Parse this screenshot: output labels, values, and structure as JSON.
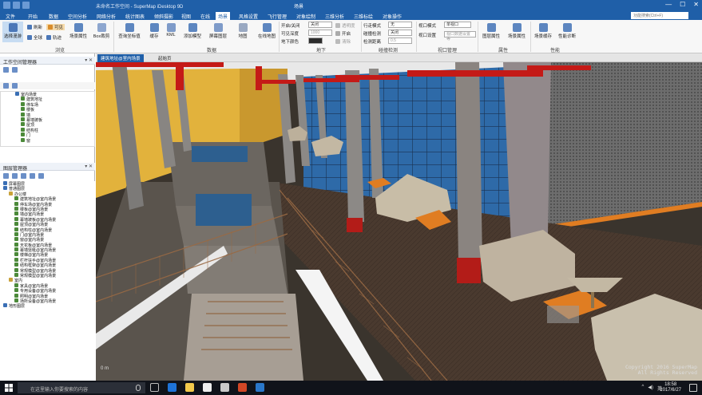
{
  "titlebar": {
    "document": "未命名工作空间 - SuperMap iDesktop 9D",
    "context_tab": "场景",
    "search_placeholder": "功能搜索(Ctrl+F)"
  },
  "ribbon_tabs": [
    "文件",
    "开始",
    "数据",
    "空间分析",
    "网络分析",
    "统计图表",
    "倾斜摄影",
    "视图",
    "在线",
    "场景",
    "风格设置",
    "飞行管理",
    "对象绘制",
    "三维分析",
    "三维标绘",
    "对象操作"
  ],
  "active_tab": "场景",
  "ribbon": {
    "browse": {
      "label": "浏览",
      "select_mode": "选择漫游",
      "refresh": "刷新",
      "fullscreen": "全球",
      "visible": "可见",
      "track": "轨迹",
      "scene_props": "场景属性",
      "box": "Box裁剪"
    },
    "data": {
      "label": "数据",
      "query": "查询坐标值",
      "cache": "缓存",
      "kml": "KML",
      "add_model": "添加模型",
      "screen_layer": "屏幕图层",
      "online_map": "在线地图",
      "underground": "地图"
    },
    "underground": {
      "label": "地下",
      "open_close": "开启/关闭",
      "visible_depth": "可见深度",
      "under_color": "地下颜色",
      "close_value": "关闭",
      "depth_value": "1000",
      "transparency": "透明度",
      "open": "开启",
      "clear": "清除"
    },
    "collision": {
      "label": "碰撞检测",
      "walk_mode": "行走模式",
      "collision_detect": "碰撞检测",
      "detect_distance": "检测距离",
      "walk_value": "无",
      "collision_value": "关闭",
      "distance_value": "0.5"
    },
    "viewport": {
      "label": "视口管理",
      "viewport_mode": "视口模式",
      "single_viewport": "单视口",
      "viewport_settings": "视口设置",
      "viewport_value": "视口数据设置等"
    },
    "properties": {
      "label": "属性",
      "layer_props": "图层属性",
      "scene_props": "场景属性"
    },
    "performance": {
      "label": "性能",
      "scene_cache": "场景缓存",
      "perf_diag": "性能诊断"
    }
  },
  "workspace_panel": {
    "title": "工作空间管理器",
    "tree": [
      {
        "level": 2,
        "text": "室内场景",
        "color": "#3a6fb5"
      },
      {
        "level": 3,
        "text": "建筑地址",
        "color": "#4c8a3a"
      },
      {
        "level": 3,
        "text": "停车场",
        "color": "#4c8a3a"
      },
      {
        "level": 3,
        "text": "楼板",
        "color": "#4c8a3a"
      },
      {
        "level": 3,
        "text": "墙",
        "color": "#4c8a3a"
      },
      {
        "level": 3,
        "text": "幕墙玻板",
        "color": "#4c8a3a"
      },
      {
        "level": 3,
        "text": "屋顶",
        "color": "#4c8a3a"
      },
      {
        "level": 3,
        "text": "结构柱",
        "color": "#4c8a3a"
      },
      {
        "level": 3,
        "text": "门",
        "color": "#4c8a3a"
      },
      {
        "level": 3,
        "text": "窗",
        "color": "#4c8a3a"
      }
    ]
  },
  "layer_panel": {
    "title": "图层管理器",
    "tree": [
      {
        "level": 0,
        "text": "屏幕图层",
        "color": "#3a6fb5"
      },
      {
        "level": 0,
        "text": "普通图层",
        "color": "#3a6fb5"
      },
      {
        "level": 1,
        "text": "办公楼",
        "color": "#c9a23a"
      },
      {
        "level": 2,
        "text": "建筑地址@室内场景",
        "color": "#4c8a3a"
      },
      {
        "level": 2,
        "text": "停车场@室内场景",
        "color": "#4c8a3a"
      },
      {
        "level": 2,
        "text": "楼板@室内场景",
        "color": "#4c8a3a"
      },
      {
        "level": 2,
        "text": "墙@室内场景",
        "color": "#4c8a3a"
      },
      {
        "level": 2,
        "text": "幕墙玻板@室内场景",
        "color": "#4c8a3a"
      },
      {
        "level": 2,
        "text": "屋顶@室内场景",
        "color": "#4c8a3a"
      },
      {
        "level": 2,
        "text": "结构柱@室内场景",
        "color": "#4c8a3a"
      },
      {
        "level": 2,
        "text": "门@室内场景",
        "color": "#4c8a3a"
      },
      {
        "level": 2,
        "text": "窗@室内场景",
        "color": "#4c8a3a"
      },
      {
        "level": 2,
        "text": "天花板@室内场景",
        "color": "#4c8a3a"
      },
      {
        "level": 2,
        "text": "幕墙竖梃@室内场景",
        "color": "#4c8a3a"
      },
      {
        "level": 2,
        "text": "楼梯@室内场景",
        "color": "#4c8a3a"
      },
      {
        "level": 2,
        "text": "栏杆扶手@室内场景",
        "color": "#4c8a3a"
      },
      {
        "level": 2,
        "text": "结构框架@室内场景",
        "color": "#4c8a3a"
      },
      {
        "level": 2,
        "text": "常规模型@室内场景",
        "color": "#4c8a3a"
      },
      {
        "level": 2,
        "text": "常规模型@室内场景",
        "color": "#4c8a3a"
      },
      {
        "level": 1,
        "text": "室内",
        "color": "#c9a23a"
      },
      {
        "level": 2,
        "text": "家具@室内场景",
        "color": "#4c8a3a"
      },
      {
        "level": 2,
        "text": "专用设备@室内场景",
        "color": "#4c8a3a"
      },
      {
        "level": 2,
        "text": "照明@室内场景",
        "color": "#4c8a3a"
      },
      {
        "level": 2,
        "text": "场所设备@室内场景",
        "color": "#4c8a3a"
      },
      {
        "level": 0,
        "text": "地形图层",
        "color": "#3a6fb5"
      }
    ]
  },
  "doc_tabs": [
    "建筑地址@室内场景",
    "起始页"
  ],
  "active_doc_tab": "建筑地址@室内场景",
  "scene": {
    "copyright_line1": "Copyright 2016 SuperMap",
    "copyright_line2": "All Rights Reserved",
    "scale_text": "0 m",
    "colors": {
      "sky": "#2a2622",
      "floor": "#4a3a2f",
      "wall_yellow": "#e2b23c",
      "pipe_red": "#c41a17",
      "glass_blue": "#2e6aa8"
    }
  },
  "taskbar": {
    "search_placeholder": "在这里输入你要搜索的内容",
    "ime": "英",
    "time": "18:58",
    "date": "2017/6/27"
  }
}
